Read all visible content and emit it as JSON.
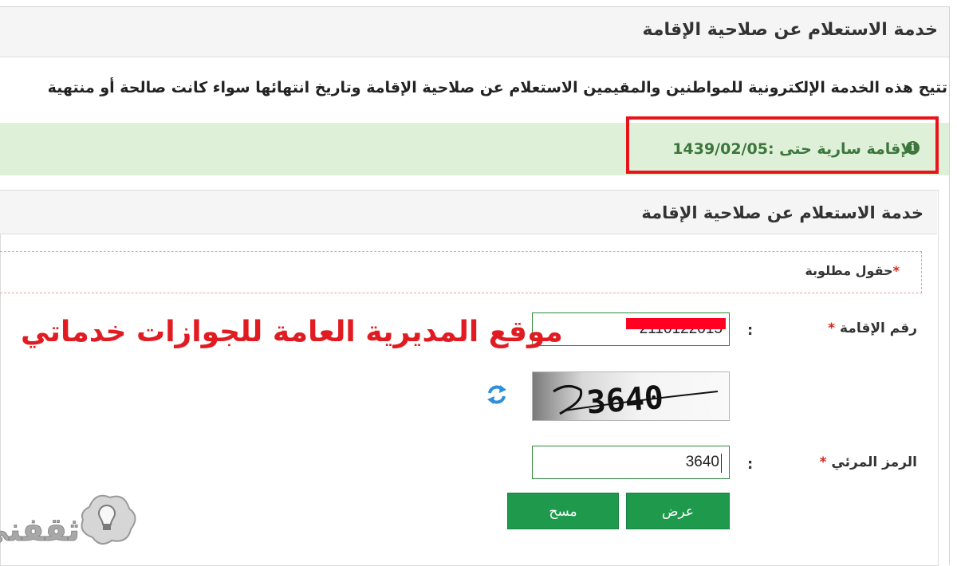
{
  "service": {
    "title": "خدمة الاستعلام عن صلاحية الإقامة",
    "description": "تتيح هذه الخدمة الإلكترونية للمواطنين والمقيمين الاستعلام عن صلاحية الإقامة وتاريخ انتهائها سواء كانت صالحة أو منتهية"
  },
  "result": {
    "label": "الإقامة سارية حتى :",
    "date": "1439/02/05",
    "icon": "info-circle-icon"
  },
  "form": {
    "title": "خدمة الاستعلام عن صلاحية الإقامة",
    "required_note": "حقول مطلوبة",
    "required_star": "*",
    "iqama_label": "رقم الإقامة",
    "iqama_value": "2110122015",
    "colon": ":",
    "captcha_label": "الرمز المرئي",
    "captcha_image_text": "3640",
    "captcha_value": "3640",
    "refresh_icon": "refresh-icon"
  },
  "buttons": {
    "view": "عرض",
    "clear": "مسح"
  },
  "overlay": {
    "watermark_text": "موقع المديرية العامة للجوازات خدماتي",
    "logo_text": "ثقفني"
  },
  "colors": {
    "alert_bg": "#dff0d8",
    "alert_text": "#3c763d",
    "highlight_border": "#e8141a",
    "button_green": "#1f9a4c",
    "required_star": "#d9241b"
  }
}
